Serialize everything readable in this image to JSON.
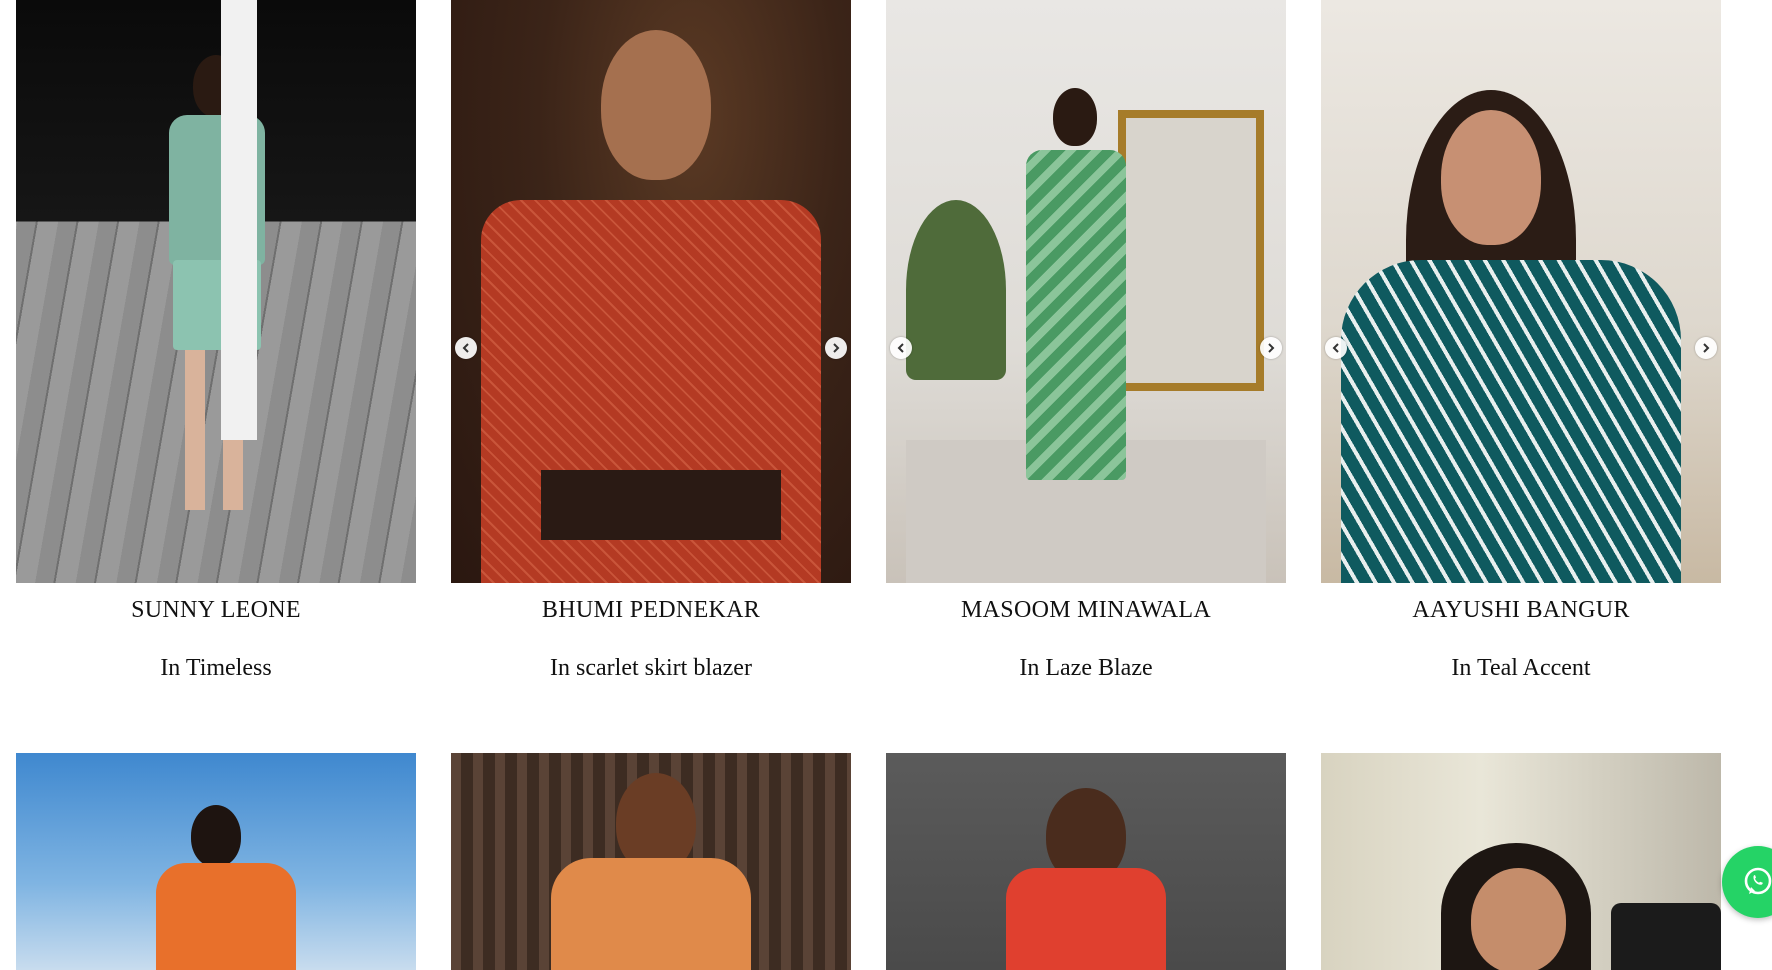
{
  "cards": [
    {
      "name": "SUNNY LEONE",
      "outfit": "In Timeless",
      "photo_alt": "Sunny Leone wearing teal printed co-ord set"
    },
    {
      "name": "BHUMI PEDNEKAR",
      "outfit": "In scarlet skirt blazer",
      "photo_alt": "Bhumi Pednekar wearing red printed blazer with belt"
    },
    {
      "name": "MASOOM MINAWALA",
      "outfit": "In Laze Blaze",
      "photo_alt": "Masoom Minawala wearing green striped suit"
    },
    {
      "name": "AAYUSHI BANGUR",
      "outfit": "In Teal Accent",
      "photo_alt": "Aayushi Bangur wearing teal geometric print dress"
    },
    {
      "photo_alt": "Woman in orange outfit under blue sky"
    },
    {
      "photo_alt": "Woman in orange blazer against wooden slats"
    },
    {
      "photo_alt": "Woman in red printed outfit against grey wall"
    },
    {
      "photo_alt": "Woman smiling in white top"
    }
  ],
  "carousel": {
    "prev_icon": "chevron-left-icon",
    "next_icon": "chevron-right-icon"
  },
  "whatsapp": {
    "icon": "whatsapp-icon",
    "color": "#25d366"
  }
}
